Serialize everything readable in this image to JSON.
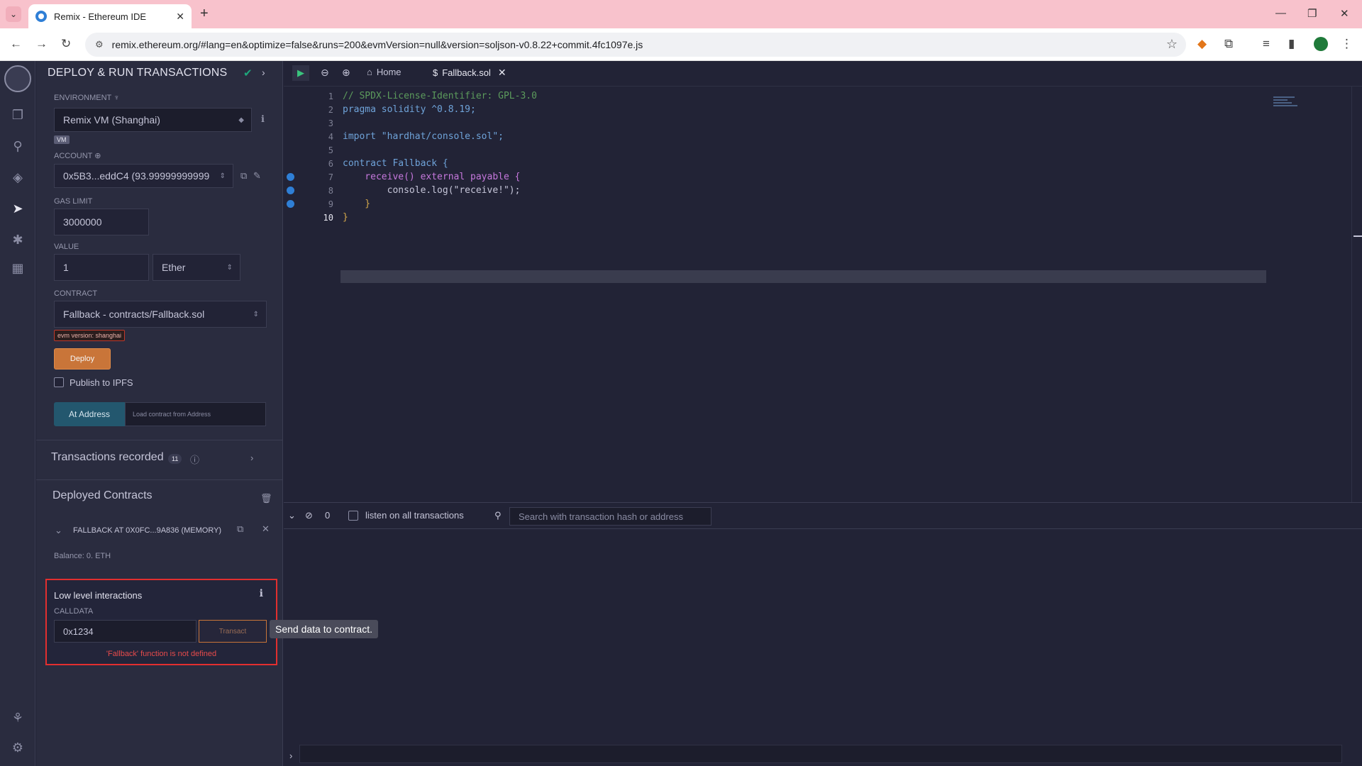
{
  "browser": {
    "tab_title": "Remix - Ethereum IDE",
    "url": "remix.ethereum.org/#lang=en&optimize=false&runs=200&evmVersion=null&version=soljson-v0.8.22+commit.4fc1097e.js"
  },
  "panel": {
    "title": "DEPLOY & RUN TRANSACTIONS",
    "environment_label": "ENVIRONMENT",
    "environment_value": "Remix VM (Shanghai)",
    "vm_badge": "VM",
    "account_label": "ACCOUNT",
    "account_value": "0x5B3...eddC4 (93.99999999999",
    "gas_limit_label": "GAS LIMIT",
    "gas_limit_value": "3000000",
    "value_label": "VALUE",
    "value_amount": "1",
    "value_unit": "Ether",
    "contract_label": "CONTRACT",
    "contract_value": "Fallback - contracts/Fallback.sol",
    "evm_badge": "evm version: shanghai",
    "deploy_label": "Deploy",
    "publish_ipfs_label": "Publish to IPFS",
    "at_address_label": "At Address",
    "load_from_address_placeholder": "Load contract from Address",
    "transactions_recorded_label": "Transactions recorded",
    "transactions_recorded_count": "11",
    "deployed_contracts_label": "Deployed Contracts",
    "instance_name": "FALLBACK AT 0X0FC...9A836 (MEMORY)",
    "balance_text": "Balance: 0. ETH",
    "low_level_title": "Low level interactions",
    "calldata_label": "CALLDATA",
    "calldata_value": "0x1234",
    "transact_label": "Transact",
    "error_text": "'Fallback' function is not defined",
    "tooltip_text": "Send data to contract."
  },
  "editor": {
    "home_tab": "Home",
    "file_tab": "Fallback.sol",
    "lines": [
      {
        "n": "1",
        "t": "// SPDX-License-Identifier: GPL-3.0"
      },
      {
        "n": "2",
        "t": "pragma solidity ^0.8.19;"
      },
      {
        "n": "3",
        "t": ""
      },
      {
        "n": "4",
        "t": "import \"hardhat/console.sol\";"
      },
      {
        "n": "5",
        "t": ""
      },
      {
        "n": "6",
        "t": "contract Fallback {"
      },
      {
        "n": "7",
        "t": "    receive() external payable {"
      },
      {
        "n": "8",
        "t": "        console.log(\"receive!\");"
      },
      {
        "n": "9",
        "t": "    }"
      },
      {
        "n": "10",
        "t": "}"
      }
    ]
  },
  "terminal": {
    "pending_count": "0",
    "listen_label": "listen on all transactions",
    "search_placeholder": "Search with transaction hash or address"
  },
  "colors": {
    "accent_deploy": "#c97539",
    "at_address_bg": "#23576e",
    "error_red": "#e84b4b",
    "highlight_border": "#e22f2f"
  },
  "icons": [
    "search-icon",
    "file-explorer-icon",
    "solidity-compiler-icon",
    "deploy-run-icon",
    "debugger-icon",
    "plugin-icon",
    "settings-icon",
    "copy-icon",
    "edit-icon",
    "info-icon",
    "trash-icon",
    "close-icon",
    "chevron-down-icon",
    "play-icon",
    "zoom-out-icon",
    "zoom-in-icon",
    "home-icon"
  ]
}
